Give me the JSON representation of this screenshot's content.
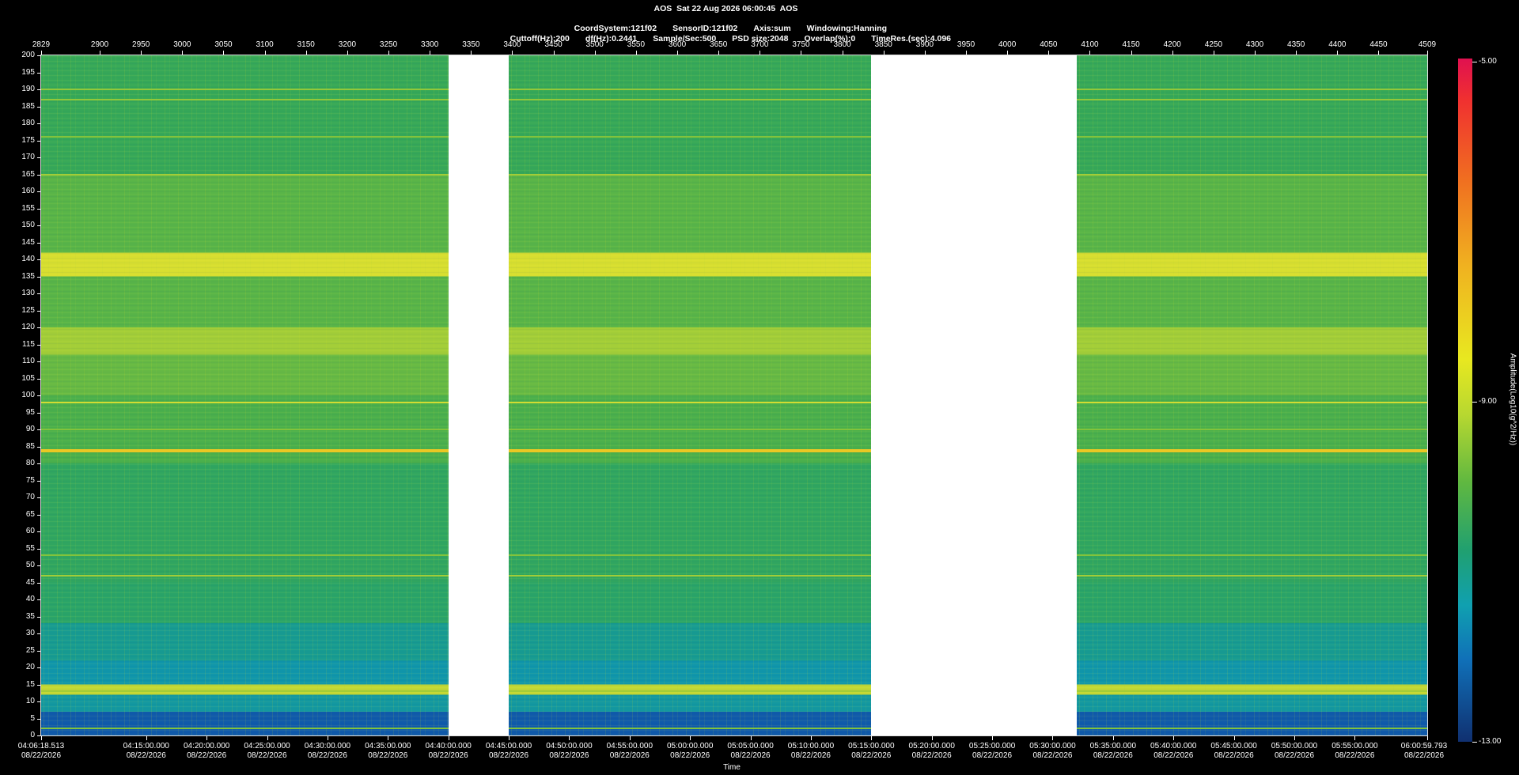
{
  "header": {
    "line1": "AOS  Sat 22 Aug 2026 06:00:45  AOS",
    "line2": [
      "CoordSystem:121f02",
      "SensorID:121f02",
      "Axis:sum",
      "Windowing:Hanning"
    ],
    "line3": [
      "Cuttoff(Hz):200",
      "df(Hz):0.2441",
      "Sample/Sec:500",
      "PSD size:2048",
      "Overlap(%):0",
      "TimeRes.(sec):4.096"
    ]
  },
  "colors": {
    "background": "#000000",
    "gap": "#ffffff",
    "dominant": "#3aa35a",
    "line_yellow": "#e6e04a",
    "line_orange": "#d98a2a"
  },
  "chart_data": {
    "type": "heatmap",
    "title": "AOS  Sat 22 Aug 2026 06:00:45  AOS",
    "ylabel": "",
    "xlabel": "Time",
    "colorbar_label": "Amplitude(Log10(g^2/Hz))",
    "ylim": [
      0,
      200
    ],
    "y_ticks": [
      "0",
      "5",
      "10",
      "15",
      "20",
      "25",
      "30",
      "35",
      "40",
      "45",
      "50",
      "55",
      "60",
      "65",
      "70",
      "75",
      "80",
      "85",
      "90",
      "95",
      "100",
      "105",
      "110",
      "115",
      "120",
      "125",
      "130",
      "135",
      "140",
      "145",
      "150",
      "155",
      "160",
      "165",
      "170",
      "175",
      "180",
      "185",
      "190",
      "195",
      "200"
    ],
    "top_axis": {
      "range": [
        2829,
        4509
      ],
      "ticks": [
        "2829",
        "2900",
        "2950",
        "3000",
        "3050",
        "3100",
        "3150",
        "3200",
        "3250",
        "3300",
        "3350",
        "3400",
        "3450",
        "3500",
        "3550",
        "3600",
        "3650",
        "3700",
        "3750",
        "3800",
        "3850",
        "3900",
        "3950",
        "4000",
        "4050",
        "4100",
        "4150",
        "4200",
        "4250",
        "4300",
        "4350",
        "4400",
        "4450",
        "4509"
      ]
    },
    "bottom_axis": {
      "ticks": [
        {
          "time": "04:06:18.513",
          "date": "08/22/2026"
        },
        {
          "time": "04:15:00.000",
          "date": "08/22/2026"
        },
        {
          "time": "04:20:00.000",
          "date": "08/22/2026"
        },
        {
          "time": "04:25:00.000",
          "date": "08/22/2026"
        },
        {
          "time": "04:30:00.000",
          "date": "08/22/2026"
        },
        {
          "time": "04:35:00.000",
          "date": "08/22/2026"
        },
        {
          "time": "04:40:00.000",
          "date": "08/22/2026"
        },
        {
          "time": "04:45:00.000",
          "date": "08/22/2026"
        },
        {
          "time": "04:50:00.000",
          "date": "08/22/2026"
        },
        {
          "time": "04:55:00.000",
          "date": "08/22/2026"
        },
        {
          "time": "05:00:00.000",
          "date": "08/22/2026"
        },
        {
          "time": "05:05:00.000",
          "date": "08/22/2026"
        },
        {
          "time": "05:10:00.000",
          "date": "08/22/2026"
        },
        {
          "time": "05:15:00.000",
          "date": "08/22/2026"
        },
        {
          "time": "05:20:00.000",
          "date": "08/22/2026"
        },
        {
          "time": "05:25:00.000",
          "date": "08/22/2026"
        },
        {
          "time": "05:30:00.000",
          "date": "08/22/2026"
        },
        {
          "time": "05:35:00.000",
          "date": "08/22/2026"
        },
        {
          "time": "05:40:00.000",
          "date": "08/22/2026"
        },
        {
          "time": "05:45:00.000",
          "date": "08/22/2026"
        },
        {
          "time": "05:50:00.000",
          "date": "08/22/2026"
        },
        {
          "time": "05:55:00.000",
          "date": "08/22/2026"
        },
        {
          "time": "06:00:59.793",
          "date": "08/22/2026"
        }
      ]
    },
    "colorbar": {
      "range": [
        -13.0,
        -5.0
      ],
      "ticks": [
        "-5.00",
        "-9.00",
        "-13.00"
      ]
    },
    "data_segments": [
      {
        "start": "04:06:18.513",
        "end": "04:40:00.000"
      },
      {
        "start": "04:45:00.000",
        "end": "05:15:00.000"
      },
      {
        "start": "05:32:00.000",
        "end": "06:00:59.793"
      }
    ],
    "gaps": [
      {
        "start": "04:40:00.000",
        "end": "04:45:00.000"
      },
      {
        "start": "05:15:00.000",
        "end": "05:32:00.000"
      }
    ],
    "frequency_bands": [
      {
        "from": 0,
        "to": 7,
        "level": -12.0
      },
      {
        "from": 7,
        "to": 12,
        "level": -10.8
      },
      {
        "from": 12,
        "to": 15,
        "level": -8.6
      },
      {
        "from": 15,
        "to": 22,
        "level": -11.0
      },
      {
        "from": 22,
        "to": 33,
        "level": -10.5
      },
      {
        "from": 33,
        "to": 45,
        "level": -9.8
      },
      {
        "from": 45,
        "to": 80,
        "level": -9.7
      },
      {
        "from": 80,
        "to": 100,
        "level": -9.4
      },
      {
        "from": 100,
        "to": 112,
        "level": -9.2
      },
      {
        "from": 112,
        "to": 120,
        "level": -8.8
      },
      {
        "from": 120,
        "to": 135,
        "level": -9.3
      },
      {
        "from": 135,
        "to": 142,
        "level": -8.4
      },
      {
        "from": 142,
        "to": 165,
        "level": -9.3
      },
      {
        "from": 165,
        "to": 200,
        "level": -9.6
      }
    ],
    "tonal_lines": [
      {
        "freq": 2,
        "level": -9.0
      },
      {
        "freq": 13,
        "level": -8.8
      },
      {
        "freq": 47,
        "level": -8.8
      },
      {
        "freq": 53,
        "level": -9.0
      },
      {
        "freq": 84,
        "level": -7.5
      },
      {
        "freq": 90,
        "level": -9.0
      },
      {
        "freq": 98,
        "level": -8.5
      },
      {
        "freq": 165,
        "level": -8.8
      },
      {
        "freq": 176,
        "level": -9.0
      },
      {
        "freq": 187,
        "level": -8.9
      },
      {
        "freq": 190,
        "level": -8.9
      }
    ]
  }
}
